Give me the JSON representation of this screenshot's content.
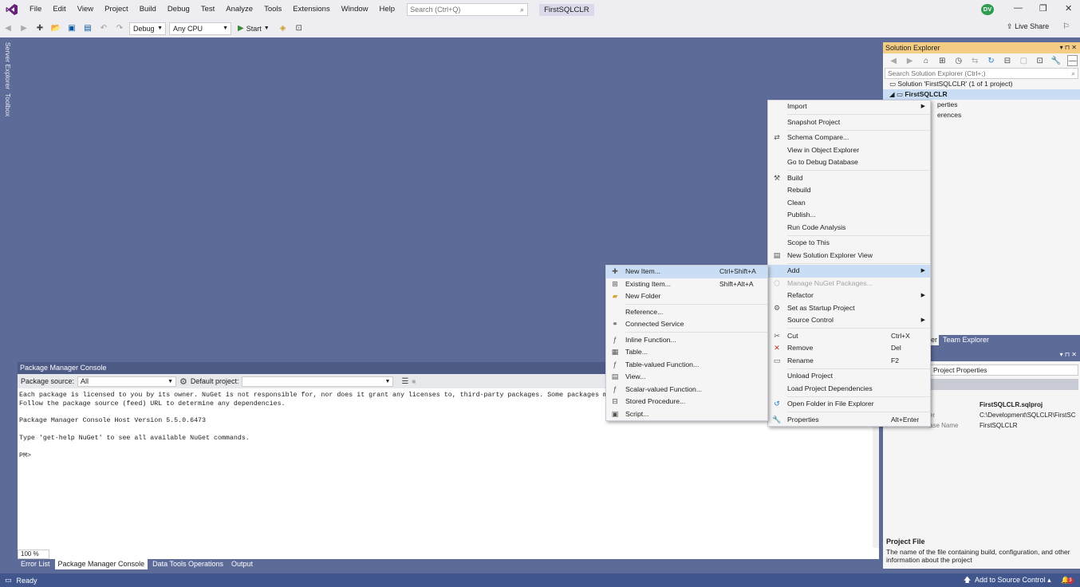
{
  "menu_bar": {
    "logo_icon": "visual-studio-logo-icon",
    "items": [
      "File",
      "Edit",
      "View",
      "Project",
      "Build",
      "Debug",
      "Test",
      "Analyze",
      "Tools",
      "Extensions",
      "Window",
      "Help"
    ],
    "search_placeholder": "Search (Ctrl+Q)",
    "project_title": "FirstSQLCLR",
    "user_initials": "DV"
  },
  "toolbar": {
    "config": "Debug",
    "platform": "Any CPU",
    "start_label": "Start",
    "live_share": "Live Share"
  },
  "side_tabs": [
    "Server Explorer",
    "Toolbox"
  ],
  "package_manager": {
    "title": "Package Manager Console",
    "source_label": "Package source:",
    "source_value": "All",
    "project_label": "Default project:",
    "project_value": "",
    "console_lines": [
      "Each package is licensed to you by its owner. NuGet is not responsible for, nor does it grant any licenses to, third-party packages. Some packages ma",
      "Follow the package source (feed) URL to determine any dependencies.",
      "",
      "Package Manager Console Host Version 5.5.0.6473",
      "",
      "Type 'get-help NuGet' to see all available NuGet commands.",
      "",
      "PM>"
    ],
    "zoom": "100 %"
  },
  "bottom_tabs": [
    "Error List",
    "Package Manager Console",
    "Data Tools Operations",
    "Output"
  ],
  "status_bar": {
    "status": "Ready",
    "source_control": "Add to Source Control",
    "notifications": "3"
  },
  "solution_explorer": {
    "title": "Solution Explorer",
    "search_placeholder": "Search Solution Explorer (Ctrl+;)",
    "solution_label": "Solution 'FirstSQLCLR' (1 of 1 project)",
    "project_label": "FirstSQLCLR",
    "child_1": "perties",
    "child_2": "erences",
    "tab_partial": "er",
    "tab_team": "Team Explorer"
  },
  "properties": {
    "combo_value": "Project Properties",
    "rows": [
      {
        "name": "",
        "value": "FirstSQLCLR.sqlproj"
      },
      {
        "name": "er",
        "value": "C:\\Development\\SQLCLR\\FirstSC"
      },
      {
        "name": "ase Name",
        "value": "FirstSQLCLR"
      }
    ],
    "desc_title": "Project File",
    "desc_text": "The name of the file containing build, configuration, and other information about the project"
  },
  "project_context_menu": [
    {
      "label": "Import",
      "submenu": true,
      "icon": ""
    },
    {
      "sep": true
    },
    {
      "label": "Snapshot Project",
      "icon": ""
    },
    {
      "sep": true
    },
    {
      "label": "Schema Compare...",
      "icon": "schema-compare-icon"
    },
    {
      "label": "View in Object Explorer",
      "icon": ""
    },
    {
      "label": "Go to Debug Database",
      "icon": ""
    },
    {
      "sep": true
    },
    {
      "label": "Build",
      "icon": "build-icon"
    },
    {
      "label": "Rebuild",
      "icon": ""
    },
    {
      "label": "Clean",
      "icon": ""
    },
    {
      "label": "Publish...",
      "icon": ""
    },
    {
      "label": "Run Code Analysis",
      "icon": ""
    },
    {
      "sep": true
    },
    {
      "label": "Scope to This",
      "icon": ""
    },
    {
      "label": "New Solution Explorer View",
      "icon": "new-view-icon"
    },
    {
      "sep": true
    },
    {
      "label": "Add",
      "submenu": true,
      "highlight": true,
      "icon": ""
    },
    {
      "label": "Manage NuGet Packages...",
      "disabled": true,
      "icon": "nuget-icon"
    },
    {
      "label": "Refactor",
      "submenu": true,
      "icon": ""
    },
    {
      "label": "Set as Startup Project",
      "icon": "gear-icon"
    },
    {
      "label": "Source Control",
      "submenu": true,
      "icon": ""
    },
    {
      "sep": true
    },
    {
      "label": "Cut",
      "shortcut": "Ctrl+X",
      "icon": "scissors-icon"
    },
    {
      "label": "Remove",
      "shortcut": "Del",
      "icon": "remove-icon"
    },
    {
      "label": "Rename",
      "shortcut": "F2",
      "icon": "rename-icon"
    },
    {
      "sep": true
    },
    {
      "label": "Unload Project",
      "icon": ""
    },
    {
      "label": "Load Project Dependencies",
      "icon": ""
    },
    {
      "sep": true
    },
    {
      "label": "Open Folder in File Explorer",
      "icon": "open-folder-icon"
    },
    {
      "sep": true
    },
    {
      "label": "Properties",
      "shortcut": "Alt+Enter",
      "icon": "wrench-icon"
    }
  ],
  "add_submenu": [
    {
      "label": "New Item...",
      "shortcut": "Ctrl+Shift+A",
      "highlight": true,
      "icon": "new-item-icon"
    },
    {
      "label": "Existing Item...",
      "shortcut": "Shift+Alt+A",
      "icon": "existing-item-icon"
    },
    {
      "label": "New Folder",
      "icon": "folder-icon"
    },
    {
      "sep": true
    },
    {
      "label": "Reference...",
      "icon": ""
    },
    {
      "label": "Connected Service",
      "icon": "connected-service-icon"
    },
    {
      "sep": true
    },
    {
      "label": "Inline Function...",
      "icon": "function-icon"
    },
    {
      "label": "Table...",
      "icon": "table-icon"
    },
    {
      "label": "Table-valued Function...",
      "icon": "function-icon"
    },
    {
      "label": "View...",
      "icon": "view-icon"
    },
    {
      "label": "Scalar-valued Function...",
      "icon": "function-icon"
    },
    {
      "label": "Stored Procedure...",
      "icon": "stored-procedure-icon"
    },
    {
      "label": "Script...",
      "icon": "script-icon"
    }
  ],
  "colors": {
    "chrome": "#eeeef2",
    "workspace": "#5d6b99",
    "accent": "#f5cc84",
    "status_bar": "#40568d",
    "menu_highlight": "#c9def5"
  }
}
